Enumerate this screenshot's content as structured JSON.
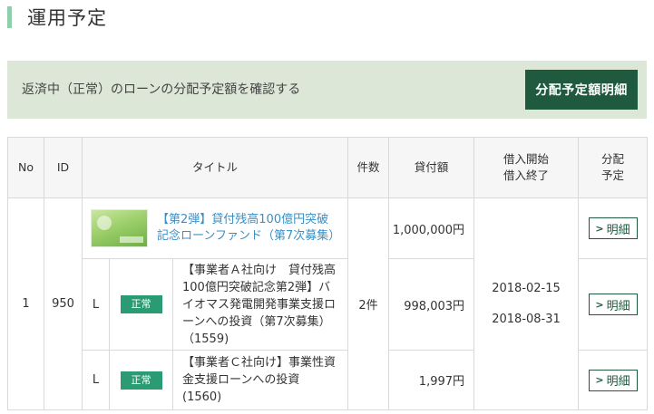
{
  "page_title": "運用予定",
  "banner": {
    "text": "返済中（正常）のローンの分配予定額を確認する",
    "button_label": "分配予定額明細"
  },
  "table": {
    "headers": {
      "no": "No",
      "id": "ID",
      "title": "タイトル",
      "count": "件数",
      "amount": "貸付額",
      "dates_1": "借入開始",
      "dates_2": "借入終了",
      "dist_1": "分配",
      "dist_2": "予定"
    },
    "group": {
      "no": "1",
      "id": "950",
      "count": "2件",
      "start_date": "2018-02-15",
      "end_date": "2018-08-31",
      "fund": {
        "title": "【第2弾】貸付残高100億円突破記念ローンファンド（第7次募集）",
        "amount": "1,000,000円",
        "detail_label": "明細"
      },
      "loans": [
        {
          "marker": "L",
          "status": "正常",
          "title": "【事業者Ａ社向け　貸付残高100億円突破記念第2弾】バイオマス発電開発事業支援ローンへの投資（第7次募集）（1559)",
          "amount": "998,003円",
          "detail_label": "明細"
        },
        {
          "marker": "L",
          "status": "正常",
          "title": "【事業者Ｃ社向け】事業性資金支援ローンへの投資 (1560)",
          "amount": "1,997円",
          "detail_label": "明細"
        }
      ]
    }
  },
  "colors": {
    "accent_dark_green": "#1f5a3f",
    "status_green": "#2a9b72",
    "banner_bg": "#dde7d8",
    "link_blue": "#3b8fc4",
    "title_bar": "#8fcfae"
  },
  "icons": {
    "detail_button_icon": "chevron-right-icon"
  }
}
